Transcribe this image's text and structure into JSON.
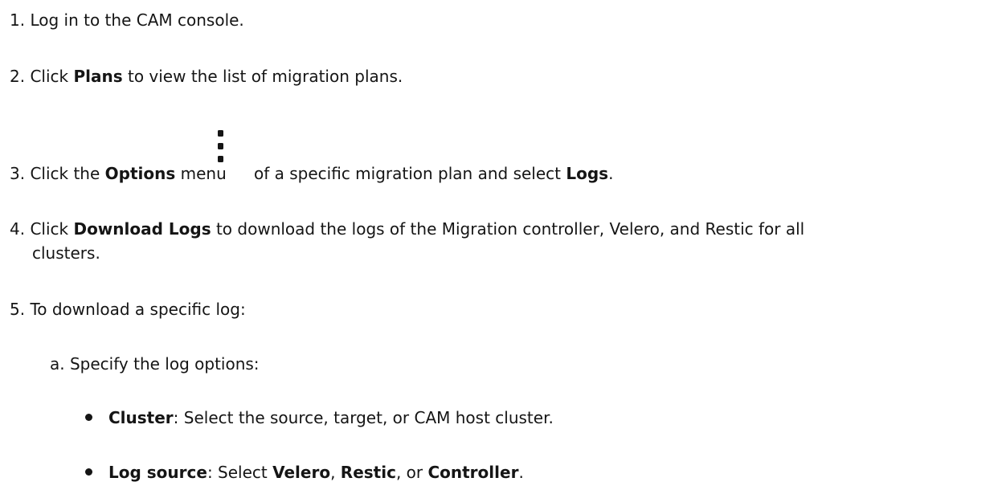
{
  "steps": [
    {
      "number": "1.",
      "text": "Log in to the CAM console."
    },
    {
      "number": "2.",
      "pre": "Click ",
      "bold": "Plans",
      "post": " to view the list of migration plans."
    },
    {
      "number": "3.",
      "pre": "Click the ",
      "bold": "Options",
      "mid": " menu",
      "icon": "kebab-menu-icon",
      "post": "of a specific migration plan and select ",
      "bold2": "Logs",
      "end": "."
    },
    {
      "number": "4.",
      "pre": "Click ",
      "bold": "Download Logs",
      "post": " to download the logs of the Migration controller, Velero, and Restic for all",
      "cont": "clusters."
    },
    {
      "number": "5.",
      "text": "To download a specific log:"
    }
  ],
  "substep": {
    "letter": "a.",
    "text": "Specify the log options:"
  },
  "bullets": [
    {
      "bold": "Cluster",
      "text": ": Select the source, target, or CAM host cluster."
    },
    {
      "bold": "Log source",
      "text": ": Select ",
      "b1": "Velero",
      "sep1": ", ",
      "b2": "Restic",
      "sep2": ", or ",
      "b3": "Controller",
      "end": "."
    }
  ]
}
